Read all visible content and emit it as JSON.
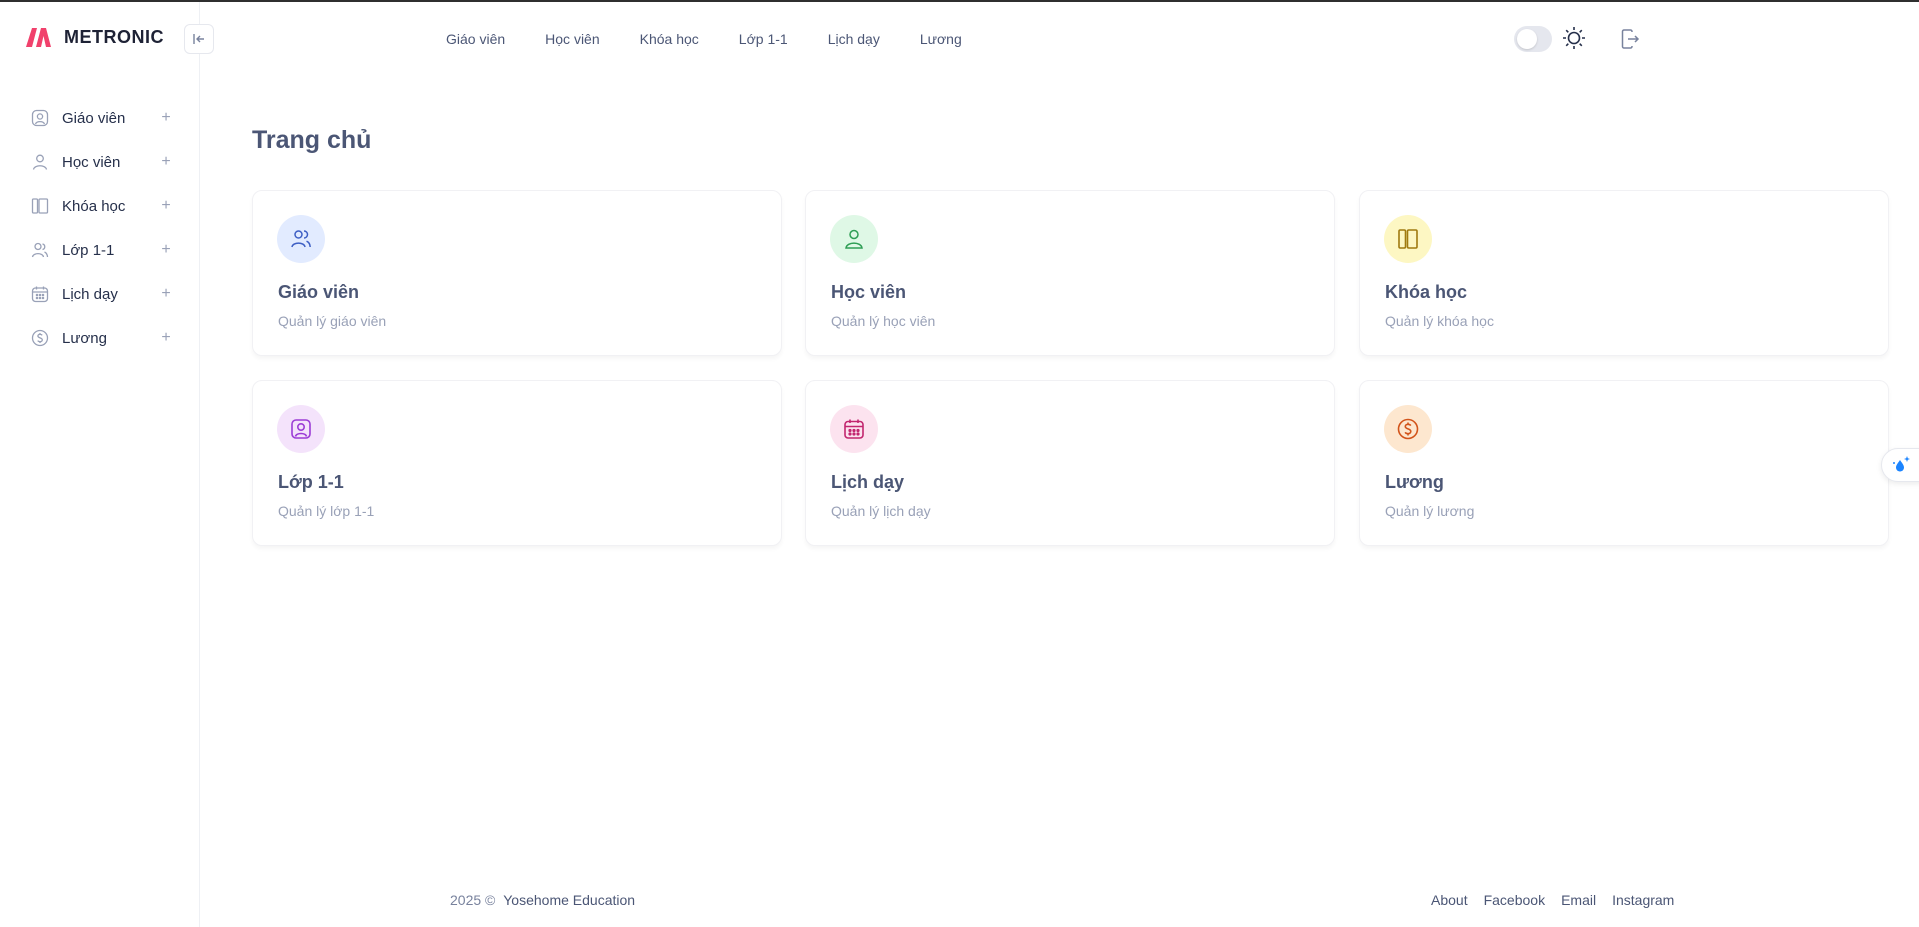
{
  "brand": {
    "name": "METRONIC"
  },
  "header": {
    "nav": [
      "Giáo viên",
      "Học viên",
      "Khóa học",
      "Lớp 1-1",
      "Lịch dạy",
      "Lương"
    ],
    "theme_toggle": {
      "state": "off"
    },
    "icons": {
      "theme": "sun-icon",
      "logout": "logout-icon",
      "collapse": "collapse-sidebar-icon"
    }
  },
  "sidebar": {
    "items": [
      {
        "label": "Giáo viên",
        "icon": "user-square-icon"
      },
      {
        "label": "Học viên",
        "icon": "user-icon"
      },
      {
        "label": "Khóa học",
        "icon": "book-panels-icon"
      },
      {
        "label": "Lớp 1-1",
        "icon": "users-icon"
      },
      {
        "label": "Lịch dạy",
        "icon": "calendar-icon"
      },
      {
        "label": "Lương",
        "icon": "dollar-circle-icon"
      }
    ],
    "expand_symbol": "+"
  },
  "main": {
    "title": "Trang chủ",
    "cards": [
      {
        "title": "Giáo viên",
        "subtitle": "Quản lý giáo viên",
        "icon": "users-icon",
        "bg": "#e2ebff",
        "color": "#3e5fc4"
      },
      {
        "title": "Học viên",
        "subtitle": "Quản lý học viên",
        "icon": "user-icon",
        "bg": "#dff8e6",
        "color": "#2f9e55"
      },
      {
        "title": "Khóa học",
        "subtitle": "Quản lý khóa học",
        "icon": "book-panels-icon",
        "bg": "#fdf7c3",
        "color": "#a07a10"
      },
      {
        "title": "Lớp 1-1",
        "subtitle": "Quản lý lớp 1-1",
        "icon": "user-square-icon",
        "bg": "#f4e3fb",
        "color": "#9b3cd6"
      },
      {
        "title": "Lịch dạy",
        "subtitle": "Quản lý lịch dạy",
        "icon": "calendar-icon",
        "bg": "#fce3ef",
        "color": "#c2266f"
      },
      {
        "title": "Lương",
        "subtitle": "Quản lý lương",
        "icon": "dollar-circle-icon",
        "bg": "#fde7cf",
        "color": "#d2541a"
      }
    ]
  },
  "footer": {
    "copyright": "2025 ©",
    "company": "Yosehome Education",
    "links": [
      "About",
      "Facebook",
      "Email",
      "Instagram"
    ]
  },
  "colors": {
    "brand_red": "#f1416c",
    "text_dark": "#252f4a",
    "text_muted": "#99a1b7"
  }
}
